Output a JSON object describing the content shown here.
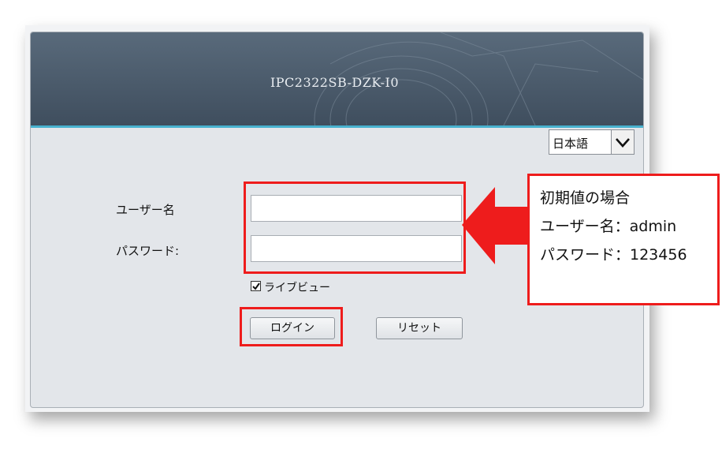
{
  "device_title": "IPC2322SB-DZK-I0",
  "language": {
    "selected": "日本語"
  },
  "form": {
    "username_label": "ユーザー名",
    "password_label": "パスワード:",
    "username_value": "",
    "password_value": "",
    "liveview_label": "ライブビュー",
    "liveview_checked": true,
    "login_button": "ログイン",
    "reset_button": "リセット"
  },
  "callout": {
    "line1": "初期値の場合",
    "line2": "ユーザー名：admin",
    "line3": "パスワード：123456"
  },
  "colors": {
    "highlight": "#ee1c1c",
    "header": "#4a5a6b",
    "header_accent": "#48b2cf"
  }
}
